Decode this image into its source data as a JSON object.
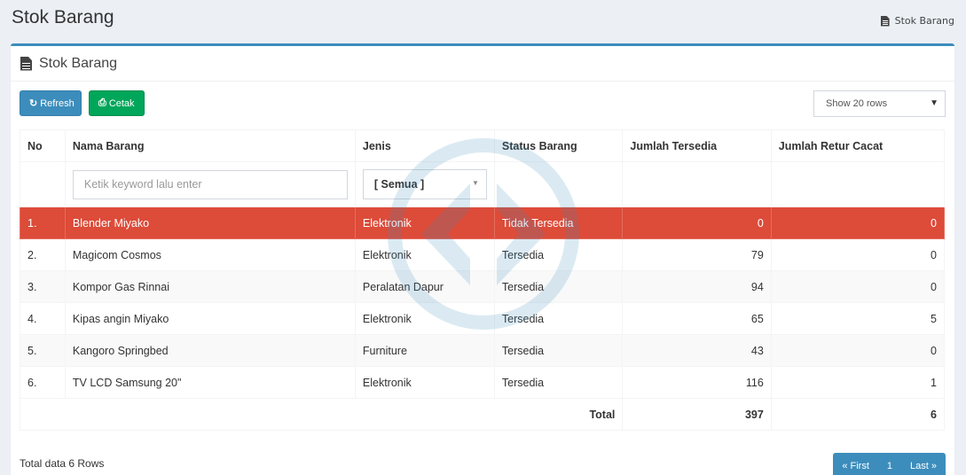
{
  "page": {
    "title": "Stok Barang"
  },
  "breadcrumb": {
    "label": "Stok Barang"
  },
  "box": {
    "title": "Stok Barang"
  },
  "toolbar": {
    "refresh_label": "Refresh",
    "cetak_label": "Cetak",
    "rows_select": "Show 20 rows"
  },
  "table": {
    "headers": [
      "No",
      "Nama Barang",
      "Jenis",
      "Status Barang",
      "Jumlah Tersedia",
      "Jumlah Retur Cacat"
    ],
    "filter": {
      "keyword_placeholder": "Ketik keyword lalu enter",
      "jenis_selected": "[ Semua ]"
    },
    "rows": [
      {
        "no": "1.",
        "nama": "Blender Miyako",
        "jenis": "Elektronik",
        "status": "Tidak Tersedia",
        "tersedia": "0",
        "retur": "0"
      },
      {
        "no": "2.",
        "nama": "Magicom Cosmos",
        "jenis": "Elektronik",
        "status": "Tersedia",
        "tersedia": "79",
        "retur": "0"
      },
      {
        "no": "3.",
        "nama": "Kompor Gas Rinnai",
        "jenis": "Peralatan Dapur",
        "status": "Tersedia",
        "tersedia": "94",
        "retur": "0"
      },
      {
        "no": "4.",
        "nama": "Kipas angin Miyako",
        "jenis": "Elektronik",
        "status": "Tersedia",
        "tersedia": "65",
        "retur": "5"
      },
      {
        "no": "5.",
        "nama": "Kangoro Springbed",
        "jenis": "Furniture",
        "status": "Tersedia",
        "tersedia": "43",
        "retur": "0"
      },
      {
        "no": "6.",
        "nama": "TV LCD Samsung 20\"",
        "jenis": "Elektronik",
        "status": "Tersedia",
        "tersedia": "116",
        "retur": "1"
      }
    ],
    "total": {
      "label": "Total",
      "tersedia": "397",
      "retur": "6"
    }
  },
  "footer": {
    "total_text": "Total data 6 Rows",
    "pagination": {
      "first": "« First",
      "page": "1",
      "last": "Last »"
    }
  },
  "colors": {
    "primary": "#3c8dbc",
    "success": "#00a65a",
    "danger": "#dd4b39"
  },
  "icons": {
    "breadcrumb": "file-icon",
    "refresh": "refresh-icon",
    "cetak": "print-icon"
  }
}
